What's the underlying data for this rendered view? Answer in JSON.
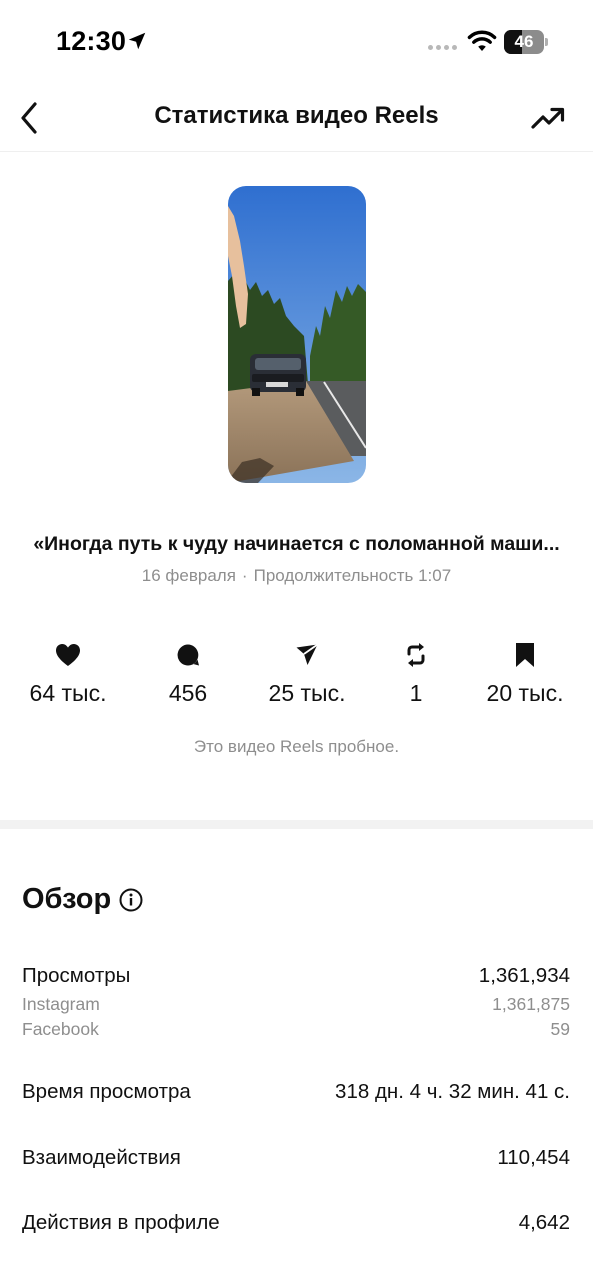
{
  "status_bar": {
    "time": "12:30",
    "battery": "46",
    "battery_level": 0.46
  },
  "header": {
    "title": "Статистика видео Reels"
  },
  "reel": {
    "caption": "«Иногда путь к чуду начинается с поломанной маши...",
    "date": "16 февраля",
    "separator": "·",
    "duration_label": "Продолжительность 1:07"
  },
  "metrics": [
    {
      "icon": "heart-icon",
      "value": "64 тыс."
    },
    {
      "icon": "comment-icon",
      "value": "456"
    },
    {
      "icon": "share-icon",
      "value": "25 тыс."
    },
    {
      "icon": "repost-icon",
      "value": "1"
    },
    {
      "icon": "bookmark-icon",
      "value": "20 тыс."
    }
  ],
  "trial_note": "Это видео Reels пробное.",
  "overview": {
    "title": "Обзор",
    "views_label": "Просмотры",
    "views_value": "1,361,934",
    "instagram_label": "Instagram",
    "instagram_value": "1,361,875",
    "facebook_label": "Facebook",
    "facebook_value": "59",
    "watch_time_label": "Время просмотра",
    "watch_time_value": "318 дн. 4 ч. 32 мин. 41 с.",
    "interactions_label": "Взаимодействия",
    "interactions_value": "110,454",
    "profile_actions_label": "Действия в профиле",
    "profile_actions_value": "4,642"
  }
}
